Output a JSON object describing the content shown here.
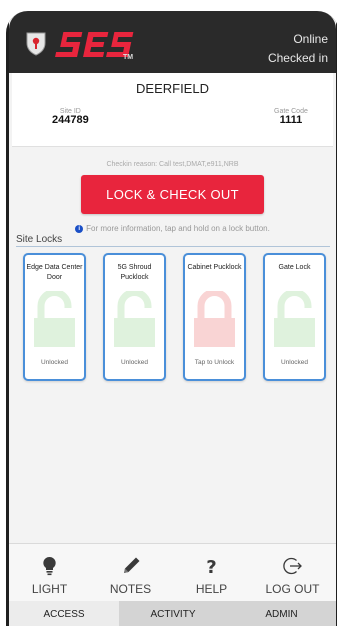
{
  "header": {
    "status_online": "Online",
    "status_checked": "Checked in",
    "logo_tm": "TM"
  },
  "site": {
    "name": "DEERFIELD",
    "site_id_label": "Site ID",
    "site_id": "244789",
    "gate_code_label": "Gate Code",
    "gate_code": "1111"
  },
  "checkin": {
    "reason_label": "Checkin reason:",
    "reason_value": "Call test,DMAT,e911,NRB"
  },
  "checkout_button": "LOCK & CHECK OUT",
  "info_text": "For more information, tap and hold on a lock button.",
  "locks_title": "Site Locks",
  "locks": [
    {
      "name": "Edge Data Center Door",
      "status": "Unlocked",
      "color": "#dff2dd"
    },
    {
      "name": "5G Shroud Pucklock",
      "status": "Unlocked",
      "color": "#dff2dd"
    },
    {
      "name": "Cabinet Pucklock",
      "status": "Tap to Unlock",
      "color": "#f9d4d4"
    },
    {
      "name": "Gate Lock",
      "status": "Unlocked",
      "color": "#dff2dd"
    }
  ],
  "tabs": [
    {
      "label": "LIGHT",
      "icon": "bulb-icon"
    },
    {
      "label": "NOTES",
      "icon": "pencil-icon"
    },
    {
      "label": "HELP",
      "icon": "question-icon"
    },
    {
      "label": "LOG OUT",
      "icon": "logout-icon"
    }
  ],
  "bottom_nav": [
    "ACCESS",
    "ACTIVITY",
    "ADMIN"
  ],
  "colors": {
    "accent_red": "#e8253d",
    "lock_border": "#4a8fd9",
    "unlocked": "#dff2dd",
    "locked": "#f9d4d4"
  }
}
